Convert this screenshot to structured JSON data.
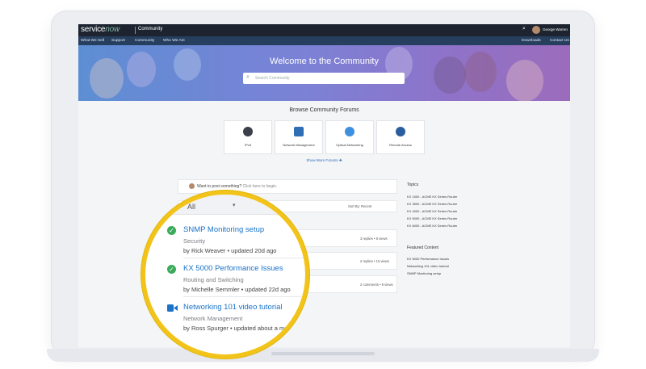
{
  "brand": {
    "logo_service": "service",
    "logo_now": "now",
    "section": "Community"
  },
  "topbar": {
    "user_name": "George Warren",
    "search_icon": "search-icon"
  },
  "nav": {
    "items": [
      "What We Sell",
      "Support",
      "Community",
      "Who We Are"
    ],
    "right": [
      "Downloads",
      "Contact Us"
    ]
  },
  "hero": {
    "title": "Welcome to the Community",
    "search_placeholder": "Search Community"
  },
  "browse": {
    "title": "Browse Community Forums",
    "forums": [
      "IPv6",
      "Network Management",
      "Optical Networking",
      "Remote Access"
    ],
    "show_more": "Show More Forums ✚"
  },
  "feed": {
    "post_prompt": "Want to post something?",
    "post_hint": "Click here to begin.",
    "sort_label": "Sort By: Recent",
    "rows": [
      {
        "meta": "3 replies • 8 views"
      },
      {
        "meta": "2 replies • 10 views"
      },
      {
        "meta": "2 comments • 9 views"
      }
    ]
  },
  "sidebar": {
    "topics_title": "Topics",
    "topics": [
      "KX 1500 - ACME KX Series Router",
      "KX 3500 - ACME KX Series Router",
      "KX 4000 - ACME KX Series Router",
      "KX 5000 - ACME KX Series Router",
      "KX 6000 - ACME KX Series Router"
    ],
    "featured_title": "Featured Content",
    "featured": [
      "KX 5000 Performance Issues",
      "Networking 101 video tutorial",
      "SNMP Monitoring setup"
    ]
  },
  "magnified": {
    "select_value": "All",
    "items": [
      {
        "title": "SNMP Monitoring setup",
        "category": "Security",
        "byline": "by Rick Weaver • updated 20d ago",
        "icon": "check-icon"
      },
      {
        "title": "KX 5000 Performance Issues",
        "category": "Routing and Switching",
        "byline": "by Michelle Semmler • updated 22d ago",
        "icon": "check-icon"
      },
      {
        "title": "Networking 101 video tutorial",
        "category": "Network Management",
        "byline": "by Ross Spurger • updated about a mo",
        "icon": "video-icon"
      }
    ]
  },
  "colors": {
    "topbar": "#1d2430",
    "nav": "#263f5f",
    "accent_link": "#1a73c8",
    "magnifier_ring": "#f2c318",
    "check_green": "#3bab5b"
  }
}
